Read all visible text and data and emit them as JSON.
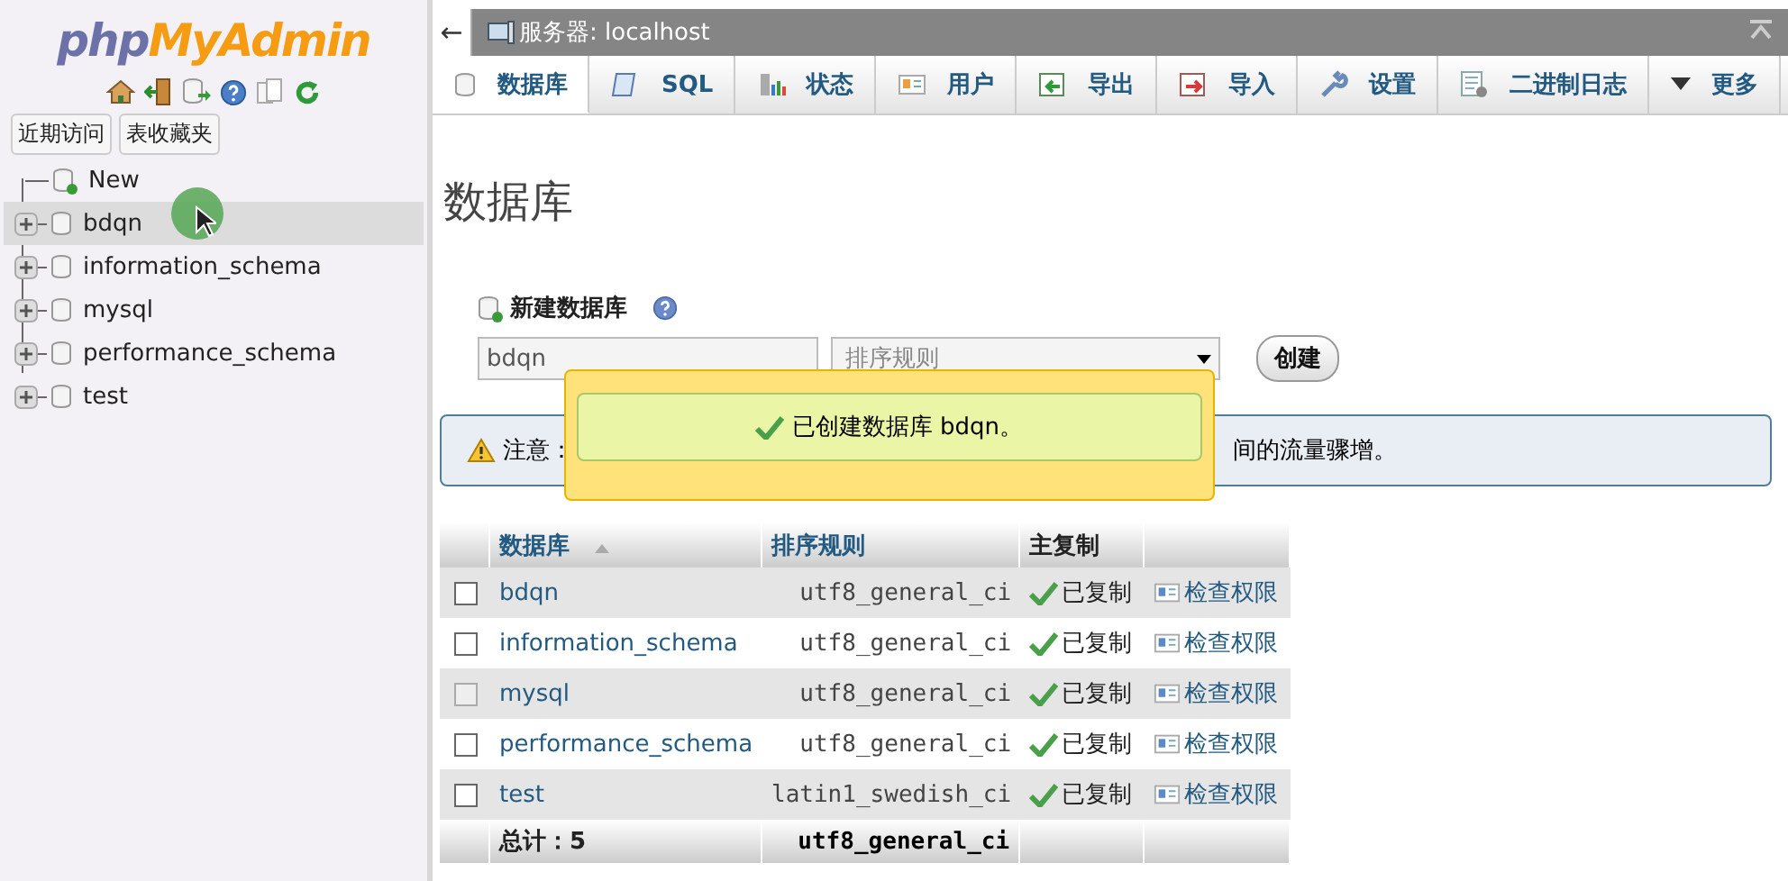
{
  "sidebar": {
    "logo": {
      "php": "php",
      "myadmin": "MyAdmin"
    },
    "buttons": [
      {
        "label": "近期访问"
      },
      {
        "label": "表收藏夹"
      }
    ],
    "tree": [
      {
        "label": "New",
        "kind": "new",
        "selected": false
      },
      {
        "label": "bdqn",
        "kind": "db",
        "selected": true
      },
      {
        "label": "information_schema",
        "kind": "db",
        "selected": false
      },
      {
        "label": "mysql",
        "kind": "db",
        "selected": false
      },
      {
        "label": "performance_schema",
        "kind": "db",
        "selected": false
      },
      {
        "label": "test",
        "kind": "db",
        "selected": false
      }
    ]
  },
  "breadcrumb": {
    "back": "←",
    "server": "服务器: localhost"
  },
  "tabs": [
    {
      "label": "数据库",
      "selected": true
    },
    {
      "label": "SQL",
      "selected": false
    },
    {
      "label": "状态",
      "selected": false
    },
    {
      "label": "用户",
      "selected": false
    },
    {
      "label": "导出",
      "selected": false
    },
    {
      "label": "导入",
      "selected": false
    },
    {
      "label": "设置",
      "selected": false
    },
    {
      "label": "二进制日志",
      "selected": false
    },
    {
      "label": "更多",
      "selected": false
    }
  ],
  "page_title": "数据库",
  "create_db": {
    "label": "新建数据库",
    "name_value": "bdqn",
    "collation_value": "排序规则",
    "button": "创建"
  },
  "notice": {
    "prefix": "注意：",
    "suffix": "间的流量骤增。"
  },
  "popup": {
    "message": "已创建数据库 bdqn。"
  },
  "table": {
    "columns": [
      "数据库",
      "排序规则",
      "主复制"
    ],
    "rows": [
      {
        "name": "bdqn",
        "collation": "utf8_general_ci",
        "replication": "已复制",
        "action": "检查权限",
        "checked": false,
        "disabled": false
      },
      {
        "name": "information_schema",
        "collation": "utf8_general_ci",
        "replication": "已复制",
        "action": "检查权限",
        "checked": false,
        "disabled": false
      },
      {
        "name": "mysql",
        "collation": "utf8_general_ci",
        "replication": "已复制",
        "action": "检查权限",
        "checked": false,
        "disabled": true
      },
      {
        "name": "performance_schema",
        "collation": "utf8_general_ci",
        "replication": "已复制",
        "action": "检查权限",
        "checked": false,
        "disabled": false
      },
      {
        "name": "test",
        "collation": "latin1_swedish_ci",
        "replication": "已复制",
        "action": "检查权限",
        "checked": false,
        "disabled": false
      }
    ],
    "footer": {
      "total": "总计：5",
      "collation": "utf8_general_ci"
    }
  }
}
